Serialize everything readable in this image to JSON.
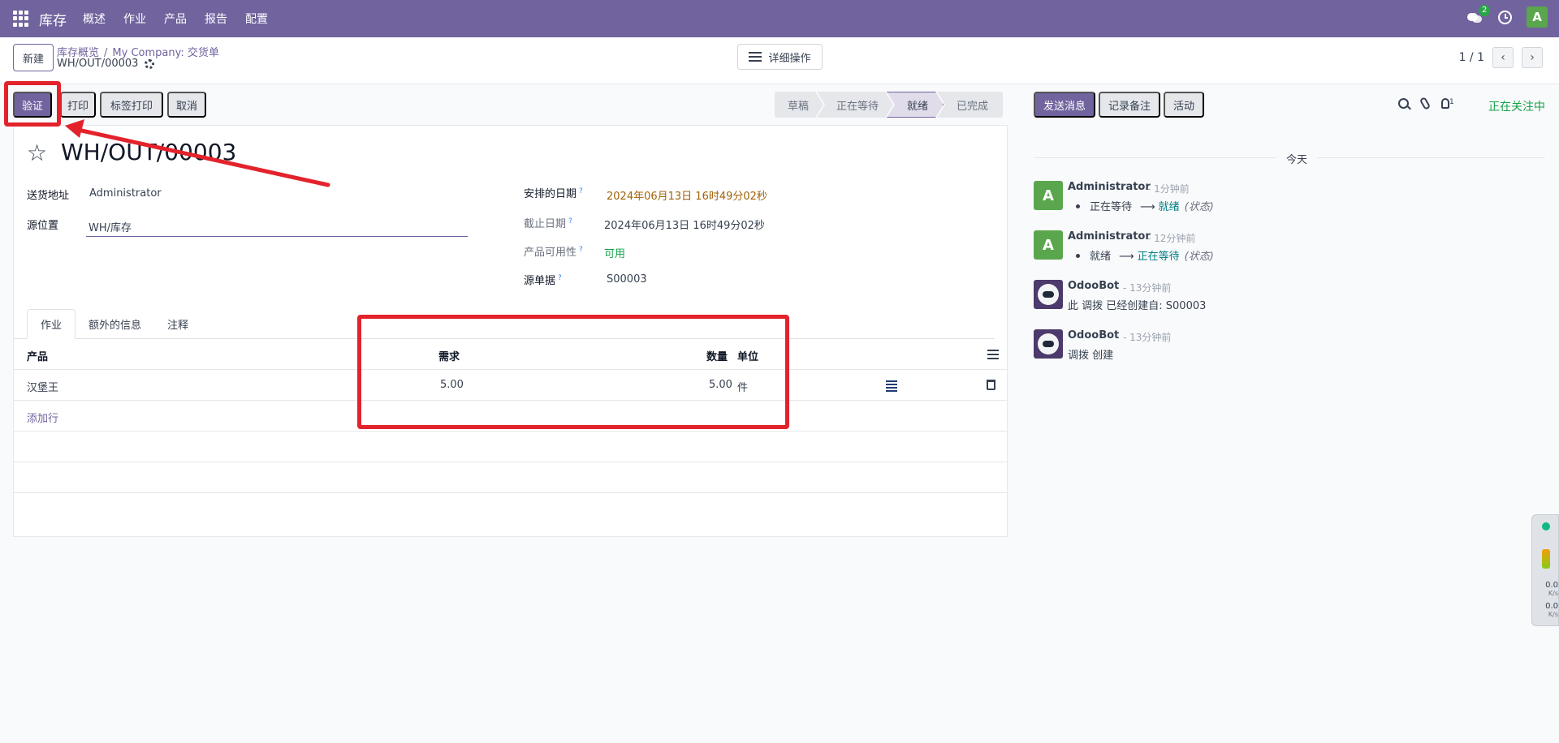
{
  "navbar": {
    "app_name": "库存",
    "menu": [
      "概述",
      "作业",
      "产品",
      "报告",
      "配置"
    ],
    "chat_badge": "2",
    "avatar_letter": "A"
  },
  "control": {
    "new_label": "新建",
    "breadcrumb": [
      "库存概览",
      "My Company: 交货单"
    ],
    "record": "WH/OUT/00003",
    "actions_label": "详细操作",
    "pager": "1 / 1"
  },
  "toolbar": {
    "validate": "验证",
    "print": "打印",
    "label_print": "标签打印",
    "cancel": "取消",
    "stages": [
      "草稿",
      "正在等待",
      "就绪",
      "已完成"
    ],
    "active_stage": "就绪"
  },
  "form": {
    "title": "WH/OUT/00003",
    "delivery_address_label": "送货地址",
    "delivery_address": "Administrator",
    "source_location_label": "源位置",
    "source_location": "WH/库存",
    "scheduled_date_label": "安排的日期",
    "scheduled_date": "2024年06月13日 16时49分02秒",
    "deadline_label": "截止日期",
    "deadline": "2024年06月13日 16时49分02秒",
    "availability_label": "产品可用性",
    "availability": "可用",
    "source_doc_label": "源单据",
    "source_doc": "S00003",
    "help_mark": "?"
  },
  "tabs": [
    "作业",
    "额外的信息",
    "注释"
  ],
  "table": {
    "headers": {
      "product": "产品",
      "demand": "需求",
      "quantity": "数量",
      "unit": "单位"
    },
    "rows": [
      {
        "product": "汉堡王",
        "demand": "5.00",
        "quantity": "5.00",
        "unit": "件"
      }
    ],
    "add_line": "添加行"
  },
  "chatter": {
    "send_message": "发送消息",
    "log_note": "记录备注",
    "activity": "活动",
    "follower_count": "1",
    "following": "正在关注中",
    "date_divider": "今天",
    "messages": [
      {
        "author": "Administrator",
        "time": "- 1分钟前",
        "avatar": "A",
        "from": "正在等待",
        "to": "就绪",
        "field": "(状态)"
      },
      {
        "author": "Administrator",
        "time": "- 12分钟前",
        "avatar": "A",
        "from": "就绪",
        "to": "正在等待",
        "field": "(状态)"
      },
      {
        "author": "OdooBot",
        "time": "- 13分钟前",
        "body": "此 调拨 已经创建自: S00003"
      },
      {
        "author": "OdooBot",
        "time": "- 13分钟前",
        "body": "调拨 创建"
      }
    ]
  },
  "widget": {
    "up_speed": "0.0",
    "up_unit": "K/s",
    "down_speed": "0.0",
    "down_unit": "K/s"
  },
  "colors": {
    "brand": "#71639e",
    "annotation": "#e3232c",
    "success": "#16a34a"
  }
}
